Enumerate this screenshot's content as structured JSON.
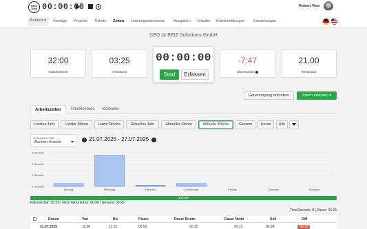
{
  "app": {
    "logo": {
      "line1": "REIZ",
      "line2": "TIME"
    },
    "top_timer": "00:00:00",
    "user_name": "Robert Reiz"
  },
  "nav": {
    "context": "Kontext ▾",
    "items": [
      "Verträge",
      "Projekte",
      "Tickets",
      "Zeiten",
      "Leistungsnachweise",
      "Ausgaben",
      "Urlaube",
      "Krankmeldungen",
      "Einstellungen"
    ],
    "active": "Zeiten"
  },
  "company": "CEO @ REIZ Solutions GmbH",
  "kpis": {
    "sollarbeitszeit": {
      "value": "32:00",
      "label": "Sollarbeitszeit"
    },
    "arbeitszeit": {
      "value": "03:25",
      "label": "Arbeitszeit"
    },
    "ueberstunden": {
      "value": "-7:47",
      "label": "Überstunden"
    },
    "resturlaub": {
      "value": "21,00",
      "label": "Resturlaub"
    }
  },
  "timer": {
    "display": "00:00:00",
    "start_label": "Start",
    "erfassen_label": "Erfassen"
  },
  "actions": {
    "genehmigung": "Genehmigung anfordern",
    "zeiten_erfassen": "Zeiten erfassen ▾"
  },
  "tabs": [
    "Arbeitszeiten",
    "TimeRecords",
    "Kalender"
  ],
  "filters": [
    "Letztes Jahr",
    "Letzter Monat",
    "Letzte Woche",
    "Aktuelles Jahr",
    "Aktueller Monat",
    "Aktuelle Woche",
    "Gestern",
    "Heute",
    "Alle"
  ],
  "active_filter": "Aktuelle Woche",
  "zeitraum": {
    "label": "Zeitraumen Filter",
    "value": "Wochen-Ansicht"
  },
  "date_range": "21.07.2025 - 27.07.2025",
  "chart_data": {
    "type": "bar",
    "categories": [
      "Montag",
      "Dienstag",
      "Mittwoch",
      "Donnerstag",
      "Freitag",
      "Samstag",
      "Sonntag"
    ],
    "values": [
      0.25,
      2.75,
      0.1,
      0.25,
      0,
      0,
      0
    ],
    "yticks": [
      "0 Stunden",
      "1 Stunden",
      "2 Stunden",
      "3 Stunden"
    ],
    "ylim": [
      0,
      3
    ],
    "grid": true,
    "bar_color": "#a9c6f0",
    "bar_border": "#4a7fd6"
  },
  "progress": {
    "value": 100,
    "label": "100.0%"
  },
  "fakturierbar": "Fakturierbar: 03:25 | Nicht fakturierbar: 00:00 | Gesamt: 03:25",
  "time_records": "TimeRecords: 8 | Dauer: 03:25",
  "table": {
    "headers": [
      "Datum",
      "Von",
      "Bis",
      "Pause",
      "Dauer Brutto",
      "Dauer Netto",
      "Soll",
      "Diff"
    ],
    "row": [
      "21.07.2025",
      "11:00",
      "11:15",
      "00:00",
      "00:15",
      "00:15",
      "06:24",
      "-06:09"
    ]
  },
  "colors": {
    "accent": "#28a745",
    "danger": "#d9534f"
  }
}
